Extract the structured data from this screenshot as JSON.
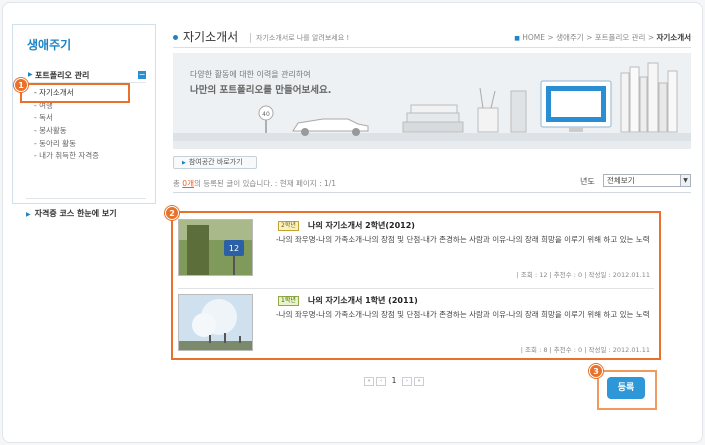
{
  "sidebar": {
    "title": "생애주기",
    "group_label": "포트폴리오 관리",
    "collapse_symbol": "−",
    "items": [
      {
        "label": "- 자기소개서"
      },
      {
        "label": "- 여행"
      },
      {
        "label": "- 독서"
      },
      {
        "label": "- 봉사활동"
      },
      {
        "label": "- 동아리 활동"
      },
      {
        "label": "- 내가 취득한 자격증"
      }
    ],
    "bottom_link": "자격증 코스 한눈에 보기"
  },
  "header": {
    "title": "자기소개서",
    "subtitle": "자기소개서로 나를 알려보세요 !",
    "breadcrumb": [
      "HOME",
      "생애주기",
      "포트폴리오 관리",
      "자기소개서"
    ]
  },
  "banner": {
    "line1": "다양한 활동에 대한 이력을 관리하여",
    "line2": "나만의 포트폴리오를 만들어보세요.",
    "sign_number": "40"
  },
  "shortcut_label": "참여공간 바로가기",
  "listing": {
    "count_prefix": "총",
    "count": "0개",
    "count_suffix": "의 등록된 글이 있습니다. : 현재 페이지 : 1/1",
    "year_label": "년도",
    "year_value": "전체보기"
  },
  "entries": [
    {
      "grade": "2학년",
      "title": "나의 자기소개서 2학년(2012)",
      "desc": "-나의 좌우명-나의 가족소개-나의 장점 및 단점-내가 존경하는 사람과 이유-나의 장래 희망을 이루기 위해 하고 있는 노력",
      "meta": "| 조회 : 12  | 추천수 : 0  |  작성일 : 2012.01.11",
      "thumb_sign": "12"
    },
    {
      "grade": "1학년",
      "title": "나의 자기소개서 1학년 (2011)",
      "desc": "-나의 좌우명-나의 가족소개-나의 장점 및 단점-내가 존경하는 사람과 이유-나의 장래 희망을 이루기 위해 하고 있는 노력",
      "meta": "| 조회 : 8  | 추천수 : 0  |  작성일 : 2012.01.11"
    }
  ],
  "pager": {
    "first": "«",
    "prev": "‹",
    "page": "1",
    "next": "›",
    "last": "»"
  },
  "register_button": "등록",
  "callouts": [
    "1",
    "2",
    "3"
  ],
  "colors": {
    "accent": "#1b84c7",
    "highlight": "#e8722c",
    "button": "#2e97d8"
  }
}
